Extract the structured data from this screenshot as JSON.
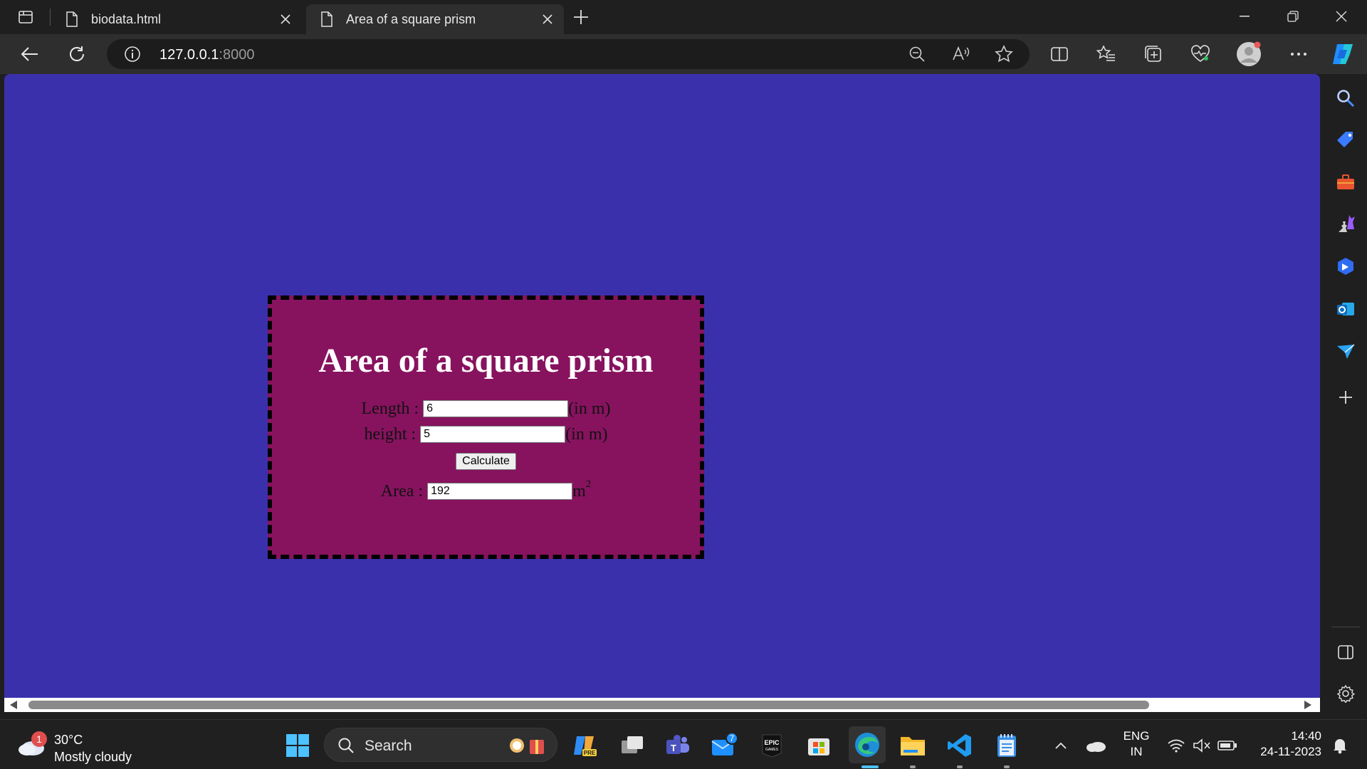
{
  "tabs": [
    {
      "title": "biodata.html",
      "active": false
    },
    {
      "title": "Area of a square prism",
      "active": true
    }
  ],
  "address": {
    "host": "127.0.0.1",
    "port": ":8000"
  },
  "page": {
    "background": "#3b30ac",
    "card_background": "#87135f",
    "heading": "Area of a square prism",
    "length_label": "Length :",
    "length_value": "6",
    "height_label": "height :",
    "height_value": "5",
    "unit": "(in m)",
    "calculate_label": "Calculate",
    "area_label": "Area :",
    "area_value": "192",
    "area_unit": "m",
    "area_unit_exp": "2"
  },
  "taskbar": {
    "weather_badge": "1",
    "temperature": "30°C",
    "condition": "Mostly cloudy",
    "search_label": "Search",
    "mail_badge": "7",
    "lang_1": "ENG",
    "lang_2": "IN",
    "time": "14:40",
    "date": "24-11-2023"
  }
}
